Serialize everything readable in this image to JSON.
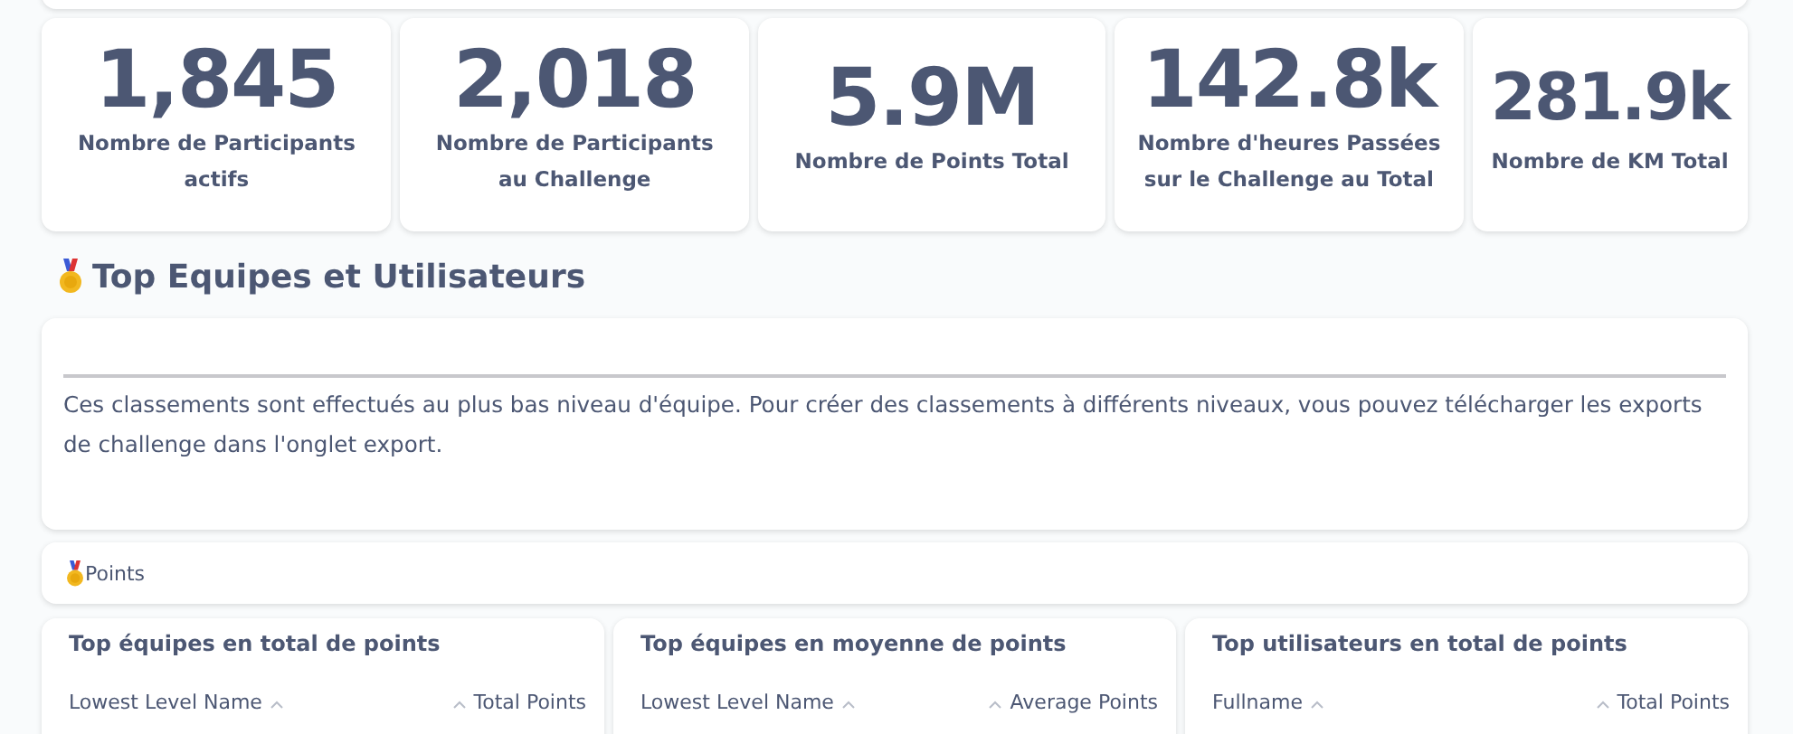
{
  "stats": [
    {
      "value": "1,845",
      "label": "Nombre de Participants actifs"
    },
    {
      "value": "2,018",
      "label": "Nombre de Participants au Challenge"
    },
    {
      "value": "5.9M",
      "label": "Nombre de Points Total"
    },
    {
      "value": "142.8k",
      "label": "Nombre d'heures Passées sur le Challenge au Total"
    },
    {
      "value": "281.9k",
      "label": "Nombre de KM Total"
    }
  ],
  "section": {
    "title": "Top Equipes et Utilisateurs",
    "note": "Ces classements sont effectués au plus bas niveau d'équipe. Pour créer des classements à différents niveaux, vous pouvez télécharger les exports de challenge dans l'onglet export."
  },
  "points_tab": {
    "label": "Points"
  },
  "tables": [
    {
      "title": "Top équipes en total de points",
      "columns": [
        "Lowest Level Name",
        "Total Points"
      ]
    },
    {
      "title": "Top équipes en moyenne de points",
      "columns": [
        "Lowest Level Name",
        "Average Points"
      ]
    },
    {
      "title": "Top utilisateurs en total de points",
      "columns": [
        "Fullname",
        "Total Points"
      ]
    }
  ]
}
